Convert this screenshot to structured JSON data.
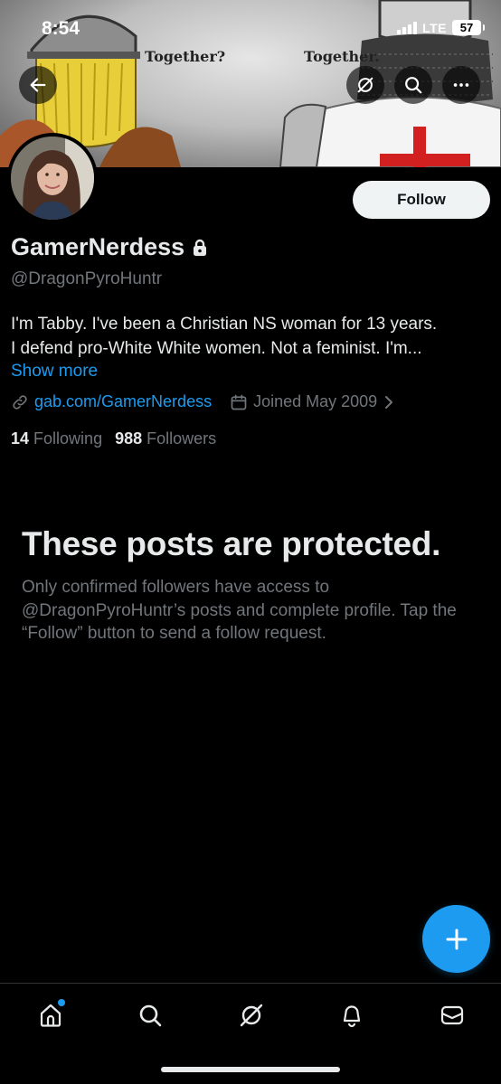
{
  "status_bar": {
    "time": "8:54",
    "network": "LTE",
    "battery": "57"
  },
  "banner": {
    "caption_left": "Together?",
    "caption_right": "Together."
  },
  "profile": {
    "follow_label": "Follow",
    "display_name": "GamerNerdess",
    "handle": "@DragonPyroHuntr",
    "bio_line1": "I'm Tabby. I've been a Christian NS woman for 13 years.",
    "bio_line2": "I defend pro-White White women. Not a feminist. I'm...",
    "show_more": "Show more",
    "link": "gab.com/GamerNerdess",
    "joined": "Joined May 2009",
    "following_count": "14",
    "following_label": "Following",
    "followers_count": "988",
    "followers_label": "Followers"
  },
  "protected": {
    "title": "These posts are protected.",
    "body": "Only confirmed followers have access to @DragonPyroHuntr’s posts and complete profile. Tap the “Follow” button to send a follow request."
  },
  "icons": {
    "back": "arrow-left-icon",
    "grok": "grok-icon",
    "search": "search-icon",
    "more": "more-icon",
    "lock": "lock-icon",
    "link": "link-icon",
    "calendar": "calendar-icon",
    "chevron": "chevron-right-icon",
    "compose": "plus-icon",
    "home": "home-icon",
    "notifications": "bell-icon",
    "messages": "mail-icon"
  },
  "colors": {
    "accent": "#1d9bf0",
    "background": "#000000",
    "text": "#e7e9ea",
    "muted": "#71767b"
  }
}
